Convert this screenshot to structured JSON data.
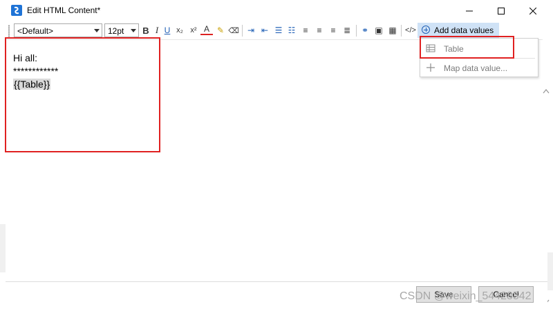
{
  "window": {
    "title": "Edit HTML Content*",
    "controls": {
      "minimize": "—",
      "maximize": "☐",
      "close": "✕"
    }
  },
  "toolbar": {
    "font_family": "<Default>",
    "font_size": "12pt",
    "buttons": [
      {
        "name": "bold",
        "glyph": "B"
      },
      {
        "name": "italic",
        "glyph": "I"
      },
      {
        "name": "underline",
        "glyph": "U"
      },
      {
        "name": "subscript",
        "glyph": "x₂"
      },
      {
        "name": "superscript",
        "glyph": "x²"
      },
      {
        "name": "font-color",
        "glyph": "A"
      },
      {
        "name": "highlight",
        "glyph": "✎"
      },
      {
        "name": "clear-format",
        "glyph": "⌫"
      },
      {
        "name": "indent",
        "glyph": "⇥"
      },
      {
        "name": "outdent",
        "glyph": "⇤"
      },
      {
        "name": "bullet-list",
        "glyph": "☰"
      },
      {
        "name": "numbered-list",
        "glyph": "☷"
      },
      {
        "name": "align-left",
        "glyph": "≡"
      },
      {
        "name": "align-center",
        "glyph": "≡"
      },
      {
        "name": "align-right",
        "glyph": "≡"
      },
      {
        "name": "justify",
        "glyph": "≣"
      },
      {
        "name": "link",
        "glyph": "⚭"
      },
      {
        "name": "image",
        "glyph": "▣"
      },
      {
        "name": "table",
        "glyph": "▦"
      },
      {
        "name": "source",
        "glyph": "</>"
      }
    ],
    "add_data_label": "Add data values"
  },
  "dropdown_menu": {
    "items": [
      {
        "label": "Table",
        "icon": "table-icon"
      },
      {
        "label": "Map data value...",
        "icon": "plus-icon"
      }
    ]
  },
  "editor": {
    "lines": [
      "Hi all:",
      "************",
      "{{Table}}"
    ]
  },
  "footer": {
    "save_label": "Save",
    "cancel_label": "Cancel"
  },
  "watermark": "CSDN @weixin_54428542",
  "colors": {
    "highlight_border": "#e02020",
    "add_data_bg": "#cfe2f6",
    "app_icon": "#1e73d6"
  }
}
